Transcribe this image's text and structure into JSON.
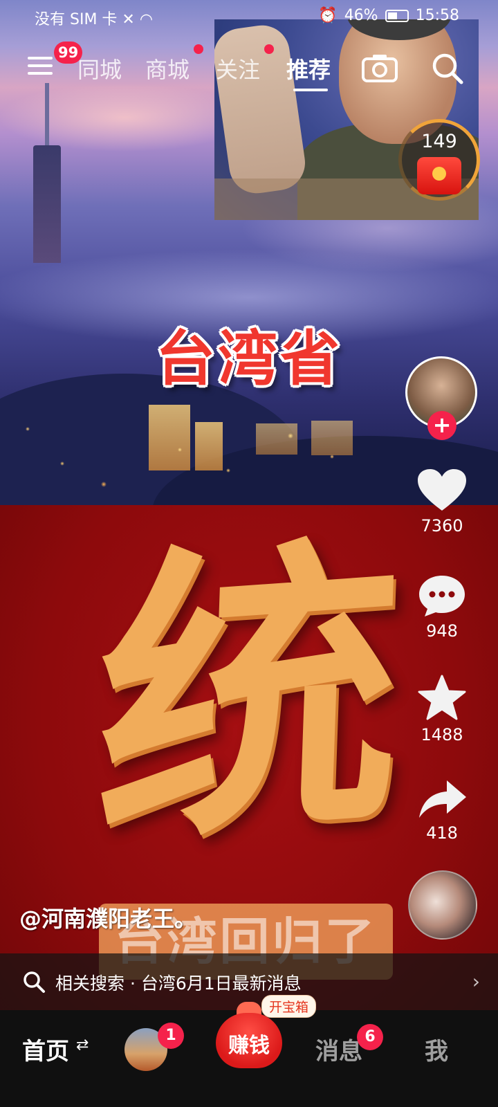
{
  "status_bar": {
    "carrier": "没有 SIM 卡",
    "battery": "46%",
    "time": "15:58"
  },
  "top_nav": {
    "menu_badge": "99",
    "tabs": [
      {
        "label": "同城",
        "has_dot": false,
        "active": false
      },
      {
        "label": "商城",
        "has_dot": true,
        "active": false
      },
      {
        "label": "关注",
        "has_dot": true,
        "active": false
      },
      {
        "label": "推荐",
        "has_dot": false,
        "active": true
      }
    ]
  },
  "video": {
    "headline": "台湾省",
    "big_character": "统",
    "subtitle_overlay": "台湾回归了",
    "author_handle": "@河南濮阳老王。"
  },
  "live_pip": {
    "red_packet_count": "149"
  },
  "actions": {
    "likes": "7360",
    "comments": "948",
    "favorites": "1488",
    "shares": "418"
  },
  "related_search": {
    "prefix": "相关搜索",
    "separator": "·",
    "query": "台湾6月1日最新消息"
  },
  "bottom_nav": {
    "home": "首页",
    "home_swap_icon": "⇄",
    "friends_badge": "1",
    "earn": "赚钱",
    "treasure": "开宝箱",
    "messages": "消息",
    "messages_badge": "6",
    "me": "我"
  },
  "colors": {
    "accent_red": "#f5224b",
    "panel_red": "#8d0a0c",
    "gold": "#f1ac5a"
  }
}
